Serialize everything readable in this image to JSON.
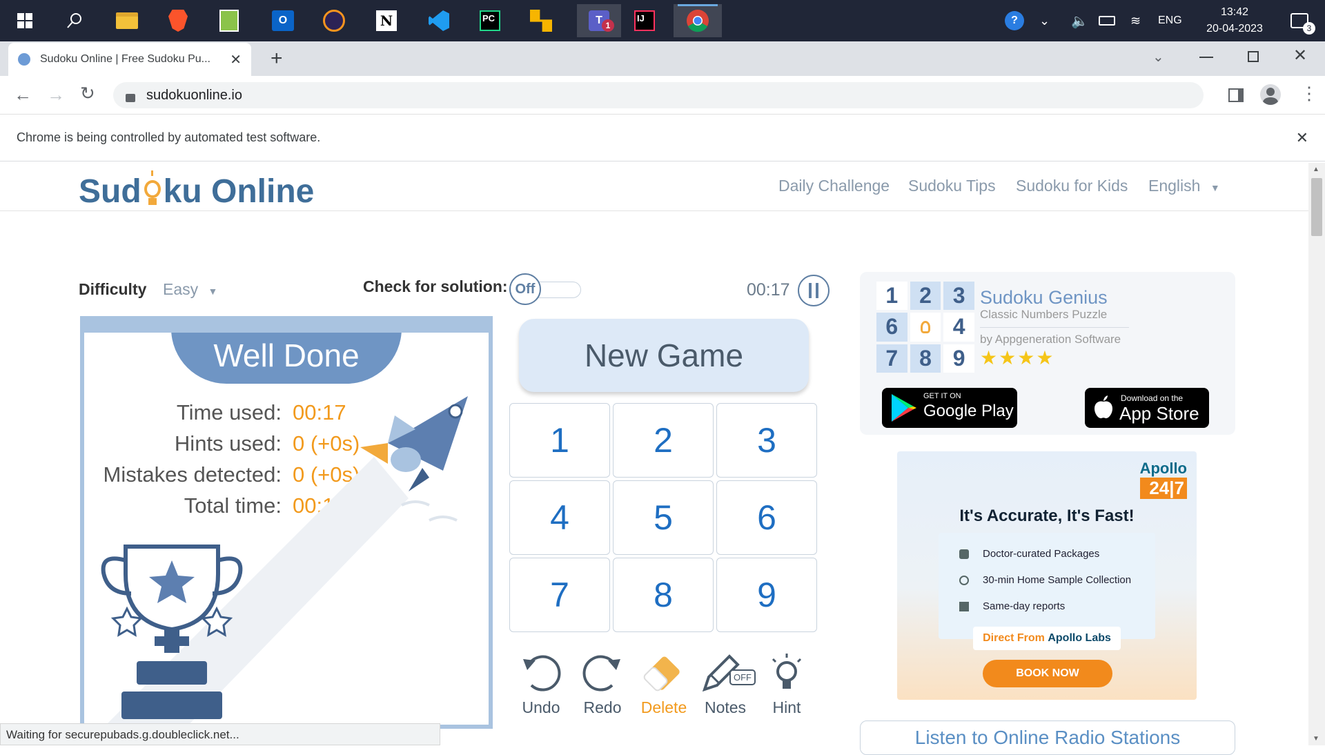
{
  "taskbar": {
    "tray": {
      "language": "ENG",
      "time": "13:42",
      "date": "20-04-2023",
      "notification_count": "3"
    },
    "teams_badge": "1"
  },
  "browser": {
    "tab_title": "Sudoku Online | Free Sudoku Pu...",
    "new_tab": "+",
    "url": "sudokuonline.io",
    "infobar_text": "Chrome is being controlled by automated test software.",
    "status_text": "Waiting for securepubads.g.doubleclick.net..."
  },
  "site": {
    "logo_prefix": "Sud",
    "logo_suffix": "ku Online",
    "nav": [
      "Daily Challenge",
      "Sudoku Tips",
      "Sudoku for Kids",
      "English"
    ],
    "difficulty_label": "Difficulty",
    "difficulty_value": "Easy",
    "check_label": "Check for solution:",
    "toggle_state": "Off",
    "timer": "00:17",
    "panel": {
      "title": "Well Done",
      "stats": [
        {
          "label": "Time used:",
          "value": "00:17"
        },
        {
          "label": "Hints used:",
          "value": "0 (+0s)"
        },
        {
          "label": "Mistakes detected:",
          "value": "0 (+0s)"
        },
        {
          "label": "Total time:",
          "value": "00:17"
        }
      ]
    },
    "new_game": "New Game",
    "numbers": [
      "1",
      "2",
      "3",
      "4",
      "5",
      "6",
      "7",
      "8",
      "9"
    ],
    "tools": [
      "Undo",
      "Redo",
      "Delete",
      "Notes",
      "Hint"
    ],
    "notes_badge": "OFF",
    "promo": {
      "app_name": "Sudoku Genius",
      "subtitle": "Classic Numbers Puzzle",
      "developer": "by Appgeneration Software",
      "rating_stars": 4,
      "grid": [
        "1",
        "2",
        "3",
        "6",
        "",
        "4",
        "7",
        "8",
        "9"
      ],
      "google_play_small": "GET IT ON",
      "google_play_big": "Google Play",
      "app_store_small": "Download on the",
      "app_store_big": "App Store"
    },
    "ad": {
      "brand": "Apollo",
      "brand_tag": "24|7",
      "headline": "It's Accurate, It's Fast!",
      "items": [
        "Doctor-curated Packages",
        "30-min Home Sample Collection",
        "Same-day reports"
      ],
      "footer_prefix": "Direct From ",
      "footer_brand": "Apollo Labs",
      "cta": "BOOK NOW"
    },
    "radio_link": "Listen to Online Radio Stations"
  },
  "colors": {
    "accent_blue": "#1e6ec2",
    "value_orange": "#f29a1d",
    "panel_header": "#6f95c4",
    "taskbar": "#202637"
  }
}
